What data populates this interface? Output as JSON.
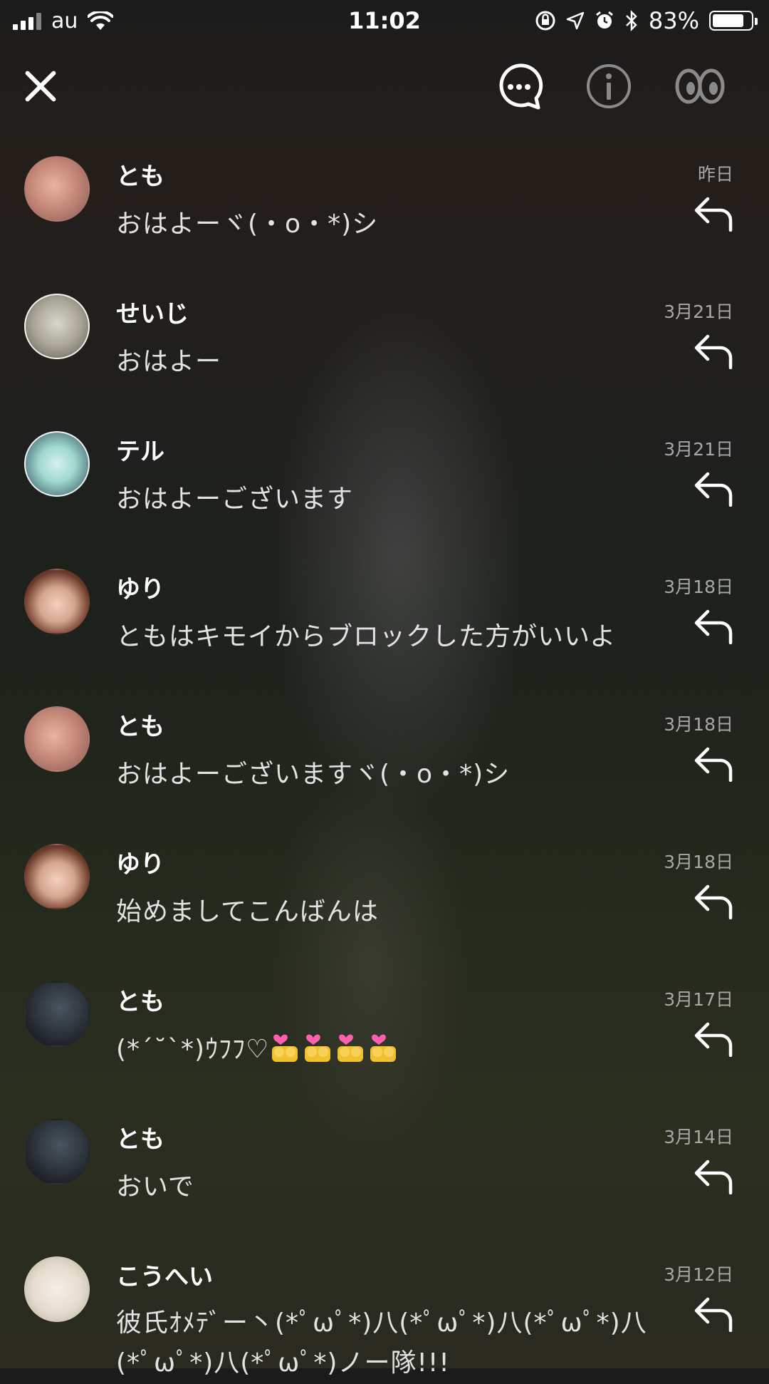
{
  "status_bar": {
    "carrier": "au",
    "time": "11:02",
    "battery": "83%",
    "battery_level": 0.83
  },
  "header": {
    "icons": [
      "close-icon",
      "chat-bubble-icon",
      "info-icon",
      "eyes-icon"
    ]
  },
  "messages": [
    {
      "name": "とも",
      "date": "昨日",
      "text": "おはよーヾ(・o・*)シ",
      "avatar": "avatar-tomo"
    },
    {
      "name": "せいじ",
      "date": "3月21日",
      "text": "おはよー",
      "avatar": "avatar-seiji"
    },
    {
      "name": "テル",
      "date": "3月21日",
      "text": "おはよーございます",
      "avatar": "avatar-teru"
    },
    {
      "name": "ゆり",
      "date": "3月18日",
      "text": "ともはキモイからブロックした方がいいよ",
      "avatar": "avatar-yuri"
    },
    {
      "name": "とも",
      "date": "3月18日",
      "text": "おはよーございますヾ(・o・*)シ",
      "avatar": "avatar-tomo"
    },
    {
      "name": "ゆり",
      "date": "3月18日",
      "text": "始めましてこんばんは",
      "avatar": "avatar-yuri"
    },
    {
      "name": "とも",
      "date": "3月17日",
      "text": "(*´˘`*)ｳﾌﾌ♡",
      "emoji_count": 4,
      "avatar": "avatar-tomo-dark"
    },
    {
      "name": "とも",
      "date": "3月14日",
      "text": "おいで",
      "avatar": "avatar-tomo-dark"
    },
    {
      "name": "こうへい",
      "date": "3月12日",
      "text": "彼氏ｵﾒﾃﾞー丶(*ﾟωﾟ*)八(*ﾟωﾟ*)八(*ﾟωﾟ*)八(*ﾟωﾟ*)八(*ﾟωﾟ*)ノー隊!!!",
      "avatar": "avatar-kouhei"
    }
  ]
}
